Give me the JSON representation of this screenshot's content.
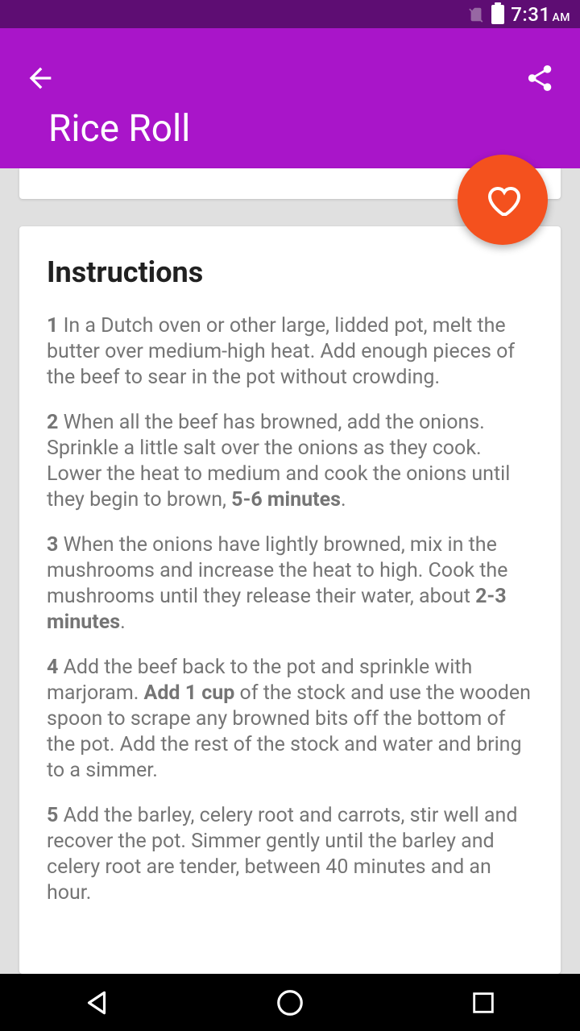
{
  "status": {
    "time": "7:31",
    "ampm": "AM"
  },
  "header": {
    "title": "Rice Roll"
  },
  "card": {
    "heading": "Instructions",
    "steps": [
      {
        "num": "1",
        "pre": "In a Dutch oven or other large, lidded pot, melt the butter over medium-high heat. Add enough pieces of the beef to sear in the pot without crowding.",
        "bold": "",
        "post": ""
      },
      {
        "num": "2",
        "pre": "When all the beef has browned, add the onions. Sprinkle a little salt over the onions as they cook. Lower the heat to medium and cook the onions until they begin to brown, ",
        "bold": "5-6 minutes",
        "post": "."
      },
      {
        "num": "3",
        "pre": "When the onions have lightly browned, mix in the mushrooms and increase the heat to high. Cook the mushrooms until they release their water, about ",
        "bold": "2-3 minutes",
        "post": "."
      },
      {
        "num": "4",
        "pre": "Add the beef back to the pot and sprinkle with marjoram. ",
        "bold": "Add 1 cup",
        "post": " of the stock and use the wooden spoon to scrape any browned bits off the bottom of the pot. Add the rest of the stock and water and bring to a simmer."
      },
      {
        "num": "5",
        "pre": "Add the barley, celery root and carrots, stir well and recover the pot. Simmer gently until the barley and celery root are tender, between 40 minutes and an hour.",
        "bold": "",
        "post": ""
      }
    ]
  }
}
